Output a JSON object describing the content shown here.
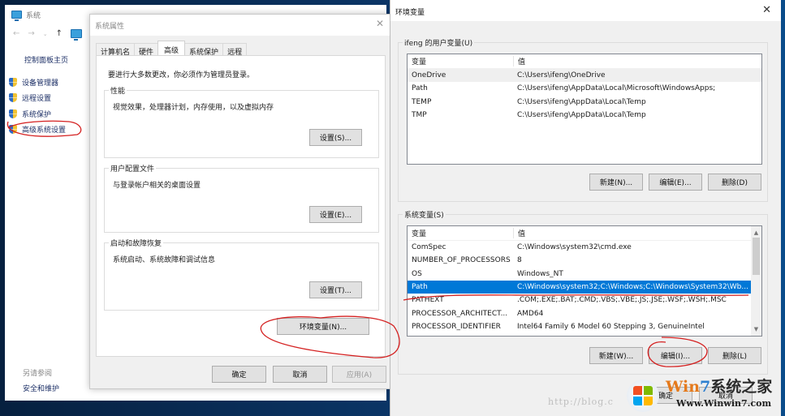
{
  "system_window": {
    "title": "系统",
    "nav": {
      "back": "←",
      "forward": "→",
      "recent": "⌄",
      "up": "↑"
    },
    "sidebar": {
      "home": "控制面板主页",
      "items": [
        {
          "label": "设备管理器",
          "icon": "uac-shield-icon"
        },
        {
          "label": "远程设置",
          "icon": "uac-shield-icon"
        },
        {
          "label": "系统保护",
          "icon": "uac-shield-icon"
        },
        {
          "label": "高级系统设置",
          "icon": "uac-shield-icon"
        }
      ],
      "see_also": "另请参阅",
      "see_also_links": [
        "安全和维护"
      ]
    }
  },
  "system_properties": {
    "title": "系统属性",
    "close": "✕",
    "tabs": [
      {
        "label": "计算机名",
        "active": false
      },
      {
        "label": "硬件",
        "active": false
      },
      {
        "label": "高级",
        "active": true
      },
      {
        "label": "系统保护",
        "active": false
      },
      {
        "label": "远程",
        "active": false
      }
    ],
    "admin_note": "要进行大多数更改，你必须作为管理员登录。",
    "groups": [
      {
        "label": "性能",
        "desc": "视觉效果，处理器计划，内存使用，以及虚拟内存",
        "button": "设置(S)..."
      },
      {
        "label": "用户配置文件",
        "desc": "与登录帐户相关的桌面设置",
        "button": "设置(E)..."
      },
      {
        "label": "启动和故障恢复",
        "desc": "系统启动、系统故障和调试信息",
        "button": "设置(T)..."
      }
    ],
    "env_button": "环境变量(N)...",
    "footer": {
      "ok": "确定",
      "cancel": "取消",
      "apply": "应用(A)"
    }
  },
  "env_vars": {
    "title": "环境变量",
    "close": "✕",
    "user_group": {
      "label": "ifeng 的用户变量(U)",
      "columns": [
        "变量",
        "值"
      ],
      "rows": [
        {
          "name": "OneDrive",
          "value": "C:\\Users\\ifeng\\OneDrive",
          "state": "hover"
        },
        {
          "name": "Path",
          "value": "C:\\Users\\ifeng\\AppData\\Local\\Microsoft\\WindowsApps;",
          "state": ""
        },
        {
          "name": "TEMP",
          "value": "C:\\Users\\ifeng\\AppData\\Local\\Temp",
          "state": ""
        },
        {
          "name": "TMP",
          "value": "C:\\Users\\ifeng\\AppData\\Local\\Temp",
          "state": ""
        }
      ],
      "buttons": {
        "new": "新建(N)...",
        "edit": "编辑(E)...",
        "delete": "删除(D)"
      }
    },
    "system_group": {
      "label": "系统变量(S)",
      "columns": [
        "变量",
        "值"
      ],
      "rows": [
        {
          "name": "ComSpec",
          "value": "C:\\Windows\\system32\\cmd.exe",
          "state": ""
        },
        {
          "name": "NUMBER_OF_PROCESSORS",
          "value": "8",
          "state": ""
        },
        {
          "name": "OS",
          "value": "Windows_NT",
          "state": ""
        },
        {
          "name": "Path",
          "value": "C:\\Windows\\system32;C:\\Windows;C:\\Windows\\System32\\Wb...",
          "state": "selected"
        },
        {
          "name": "PATHEXT",
          "value": ".COM;.EXE;.BAT;.CMD;.VBS;.VBE;.JS;.JSE;.WSF;.WSH;.MSC",
          "state": ""
        },
        {
          "name": "PROCESSOR_ARCHITECT...",
          "value": "AMD64",
          "state": ""
        },
        {
          "name": "PROCESSOR_IDENTIFIER",
          "value": "Intel64 Family 6 Model 60 Stepping 3, GenuineIntel",
          "state": ""
        }
      ],
      "buttons": {
        "new": "新建(W)...",
        "edit": "编辑(I)...",
        "delete": "删除(L)"
      }
    },
    "footer": {
      "ok": "确定",
      "cancel": "取消"
    }
  },
  "watermark": {
    "url_text": "http://blog.c",
    "brand_w": "Win",
    "brand_7": "7",
    "brand_cn": "系统之家",
    "brand_url": "Www.Winwin7.com"
  },
  "colors": {
    "selection": "#0078d7",
    "annotation": "#d42020",
    "link": "#1c2f66"
  }
}
